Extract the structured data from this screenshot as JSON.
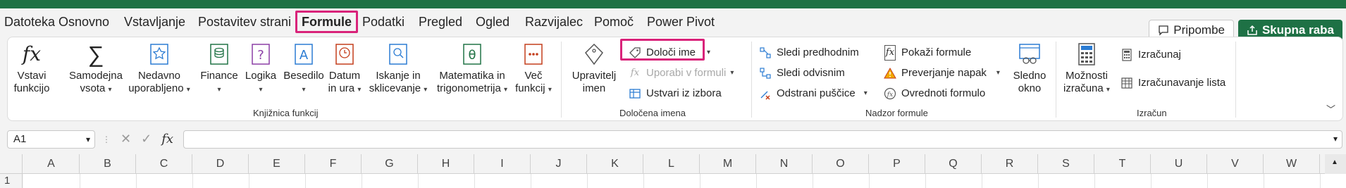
{
  "menu": {
    "items": [
      "Datoteka",
      "Osnovno",
      "Vstavljanje",
      "Postavitev strani",
      "Formule",
      "Podatki",
      "Pregled",
      "Ogled",
      "Razvijalec",
      "Pomoč",
      "Power Pivot"
    ],
    "active": "Formule",
    "comments": "Pripombe",
    "share": "Skupna raba"
  },
  "ribbon": {
    "library": {
      "insert_function": [
        "Vstavi",
        "funkcijo"
      ],
      "autosum": [
        "Samodejna",
        "vsota"
      ],
      "recent": [
        "Nedavno",
        "uporabljeno"
      ],
      "finance": "Finance",
      "logical": "Logika",
      "text": "Besedilo",
      "datetime": [
        "Datum",
        "in ura"
      ],
      "lookup": [
        "Iskanje in",
        "sklicevanje"
      ],
      "math": [
        "Matematika in",
        "trigonometrija"
      ],
      "more": [
        "Več",
        "funkcij"
      ],
      "group_label": "Knjižnica funkcij"
    },
    "names": {
      "name_manager": [
        "Upravitelj",
        "imen"
      ],
      "define_name": "Določi ime",
      "use_in_formula": "Uporabi v formuli",
      "create_from_selection": "Ustvari iz izbora",
      "group_label": "Določena imena"
    },
    "audit": {
      "trace_precedents": "Sledi predhodnim",
      "trace_dependents": "Sledi odvisnim",
      "remove_arrows": "Odstrani puščice",
      "show_formulas": "Pokaži formule",
      "error_checking": "Preverjanje napak",
      "evaluate_formula": "Ovrednoti formulo",
      "watch_window": [
        "Sledno",
        "okno"
      ],
      "group_label": "Nadzor formule"
    },
    "calc": {
      "options": [
        "Možnosti",
        "izračuna"
      ],
      "calc_now": "Izračunaj",
      "calc_sheet": "Izračunavanje lista",
      "group_label": "Izračun"
    }
  },
  "formula_bar": {
    "name_box": "A1",
    "fx": "fx",
    "value": ""
  },
  "grid": {
    "columns": [
      "A",
      "B",
      "C",
      "D",
      "E",
      "F",
      "G",
      "H",
      "I",
      "J",
      "K",
      "L",
      "M",
      "N",
      "O",
      "P",
      "Q",
      "R",
      "S",
      "T",
      "U",
      "V",
      "W"
    ],
    "rows": [
      "1"
    ]
  },
  "colors": {
    "accent_green": "#1e7145",
    "highlight": "#d9237a"
  }
}
